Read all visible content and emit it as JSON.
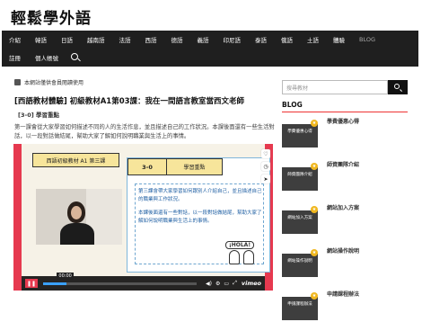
{
  "site": {
    "title": "輕鬆學外語"
  },
  "nav": {
    "row1": [
      "介紹",
      "韓語",
      "日語",
      "越南語",
      "法語",
      "西語",
      "德語",
      "義語",
      "印尼語",
      "泰語",
      "俄語",
      "土語",
      "體驗",
      "BLOG"
    ],
    "row2": [
      "註冊",
      "個人帳號"
    ],
    "search_icon": "search-icon"
  },
  "notice": "本網站僅供會員閱讀使用",
  "post": {
    "title": "[西語教材體驗] 初級教材A1第03課：我在一間語言教室當西文老師",
    "tag": "[3-0] 學習重點",
    "intro": "第一課會從大家學習如何描述不同的人的生活作息，並且描述自己的工作狀況。本課後面還有一些生活對話，以一段對話做結尾，幫助大家了解如何說明職業與生活上的事情。"
  },
  "video": {
    "lesson_badge": "西語初級教材 A1 第三課",
    "slide_number": "3-0",
    "slide_topic": "學習重點",
    "slide_paragraph1": "第三課會帶大家學習如何跟別人介紹自己，並且描述自己的職業與工作狀況。",
    "slide_paragraph2": "本課後面還有一些對話，以一段對話做結尾，幫助大家了解如何說明職業與生活上的事情。",
    "sticker_text": "¡HOLA!",
    "time_label": "00:00",
    "progress_percent": 15,
    "brand": "vimeo"
  },
  "sidebar": {
    "search_placeholder": "搜尋教材",
    "blog_heading": "BLOG",
    "items": [
      {
        "label": "學費優惠心得",
        "thumb_text": "學費優惠心得"
      },
      {
        "label": "師資團隊介紹",
        "thumb_text": "師資團隊介紹"
      },
      {
        "label": "網站加入方案",
        "thumb_text": "網站加入方案"
      },
      {
        "label": "網站操作說明",
        "thumb_text": "網站操作說明"
      },
      {
        "label": "申請課程辦法",
        "thumb_text": "申請課程辦法"
      }
    ]
  },
  "colors": {
    "accent": "#e6394f",
    "nav_bg": "#1f1f1f",
    "slide_tab": "#f7e59b",
    "progress": "#3aa0ff"
  }
}
